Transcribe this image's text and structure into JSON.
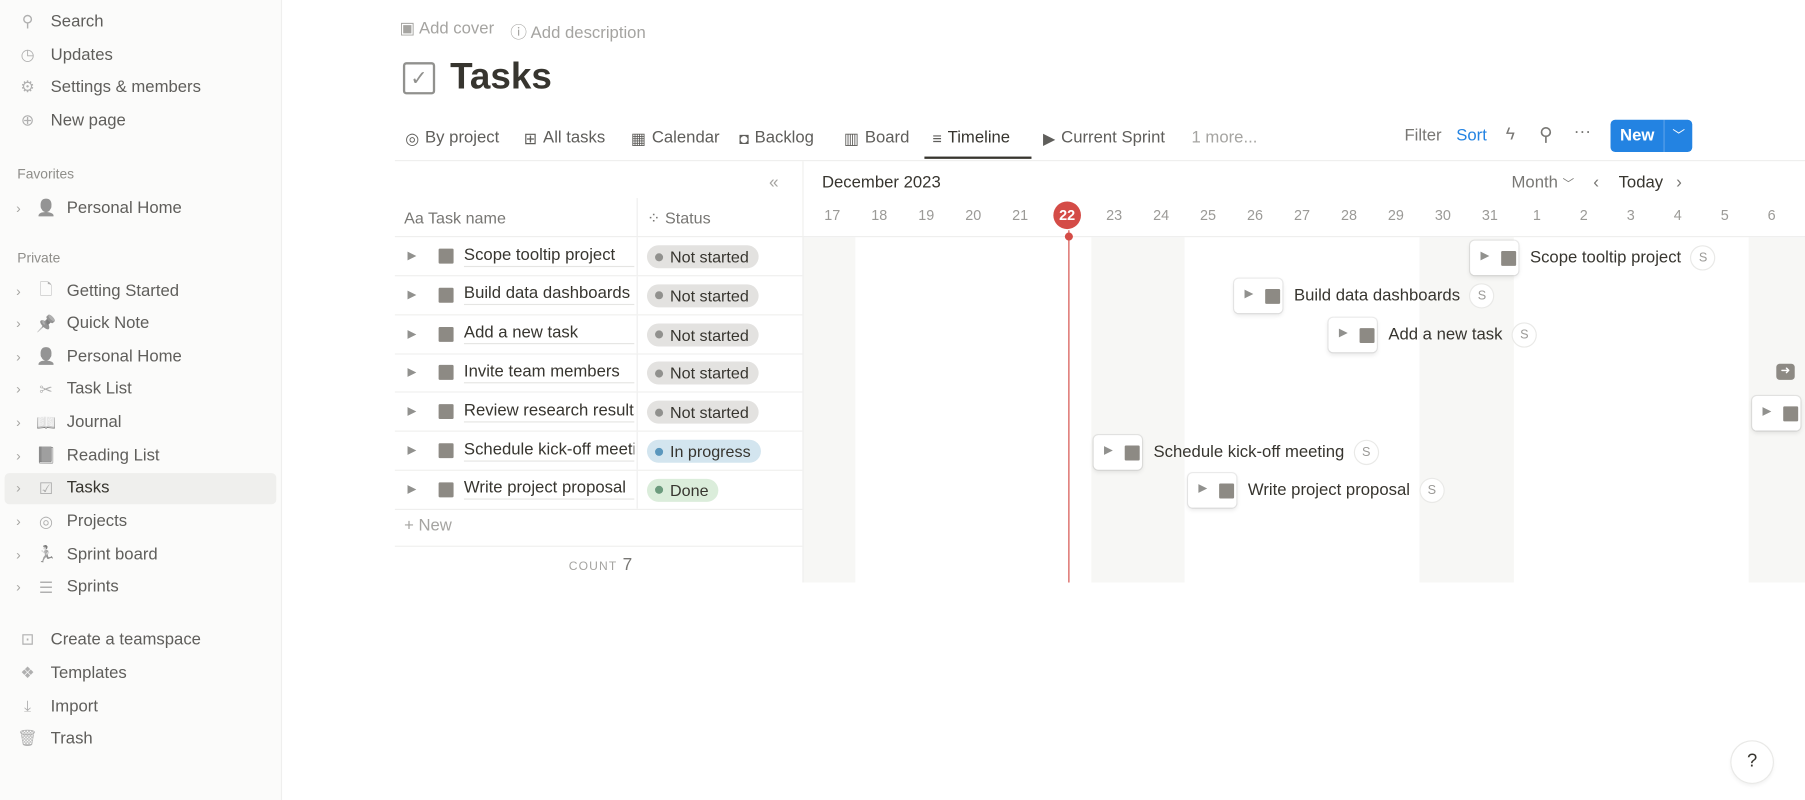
{
  "sidebar": {
    "top": [
      {
        "label": "Search",
        "icon": "search-icon"
      },
      {
        "label": "Updates",
        "icon": "clock-icon"
      },
      {
        "label": "Settings & members",
        "icon": "gear-icon"
      },
      {
        "label": "New page",
        "icon": "plus-circle-icon"
      }
    ],
    "favorites_label": "Favorites",
    "favorites": [
      {
        "label": "Personal Home",
        "icon": "person-icon"
      }
    ],
    "private_label": "Private",
    "private": [
      {
        "label": "Getting Started",
        "icon": "page-icon"
      },
      {
        "label": "Quick Note",
        "icon": "pin-icon"
      },
      {
        "label": "Personal Home",
        "icon": "person-icon"
      },
      {
        "label": "Task List",
        "icon": "scissors-icon"
      },
      {
        "label": "Journal",
        "icon": "book-open-icon"
      },
      {
        "label": "Reading List",
        "icon": "book-icon"
      },
      {
        "label": "Tasks",
        "icon": "checkbox-icon",
        "active": true
      },
      {
        "label": "Projects",
        "icon": "target-icon"
      },
      {
        "label": "Sprint board",
        "icon": "runner-icon"
      },
      {
        "label": "Sprints",
        "icon": "database-icon"
      }
    ],
    "bottom": [
      {
        "label": "Create a teamspace",
        "icon": "teamspace-icon"
      },
      {
        "label": "Templates",
        "icon": "templates-icon"
      },
      {
        "label": "Import",
        "icon": "download-icon"
      },
      {
        "label": "Trash",
        "icon": "trash-icon"
      }
    ]
  },
  "page": {
    "add_cover": "Add cover",
    "add_description": "Add description",
    "title": "Tasks"
  },
  "tabs": [
    {
      "label": "By project",
      "icon": "◎"
    },
    {
      "label": "All tasks",
      "icon": "⊞"
    },
    {
      "label": "Calendar",
      "icon": "▦"
    },
    {
      "label": "Backlog",
      "icon": "◘"
    },
    {
      "label": "Board",
      "icon": "▥"
    },
    {
      "label": "Timeline",
      "icon": "≡",
      "active": true
    },
    {
      "label": "Current Sprint",
      "icon": "▶"
    },
    {
      "label": "1 more...",
      "icon": ""
    }
  ],
  "toolbar": {
    "filter": "Filter",
    "sort": "Sort",
    "new": "New"
  },
  "table": {
    "col_name": "Task name",
    "col_name_prefix": "Aa",
    "col_status": "Status",
    "new_row": "New",
    "count_label": "COUNT",
    "count": "7",
    "rows": [
      {
        "name": "Scope tooltip project",
        "status": "Not started"
      },
      {
        "name": "Build data dashboards",
        "status": "Not started"
      },
      {
        "name": "Add a new task",
        "status": "Not started"
      },
      {
        "name": "Invite team members",
        "status": "Not started"
      },
      {
        "name": "Review research results",
        "status": "Not started"
      },
      {
        "name": "Schedule kick-off meeting",
        "status": "In progress"
      },
      {
        "name": "Write project proposal",
        "status": "Done"
      }
    ]
  },
  "status_colors": {
    "Not started": {
      "bg": "#e3e2e0",
      "dot": "#91918e"
    },
    "In progress": {
      "bg": "#d3e5ef",
      "dot": "#5b97bd"
    },
    "Done": {
      "bg": "#dbeddb",
      "dot": "#6c9b7d"
    }
  },
  "timeline": {
    "month": "December 2023",
    "scale": "Month",
    "today": "Today",
    "today_day": "22",
    "today_color": "#d44c47",
    "days": [
      "17",
      "18",
      "19",
      "20",
      "21",
      "22",
      "23",
      "24",
      "25",
      "26",
      "27",
      "28",
      "29",
      "30",
      "31",
      "1",
      "2",
      "3",
      "4",
      "5",
      "6"
    ],
    "cards": [
      {
        "label": "Scope tooltip project",
        "avatar": "S",
        "start": "2023-12-31"
      },
      {
        "label": "Build data dashboards",
        "avatar": "S",
        "start": "2023-12-26"
      },
      {
        "label": "Add a new task",
        "avatar": "S",
        "start": "2023-12-28"
      },
      {
        "label": "",
        "avatar": "",
        "start": "offscreen"
      },
      {
        "label": "",
        "avatar": "",
        "start": "2024-01-06"
      },
      {
        "label": "Schedule kick-off meeting",
        "avatar": "S",
        "start": "2023-12-23"
      },
      {
        "label": "Write project proposal",
        "avatar": "S",
        "start": "2023-12-25"
      }
    ]
  },
  "help": "?",
  "accent": "#2383e2"
}
